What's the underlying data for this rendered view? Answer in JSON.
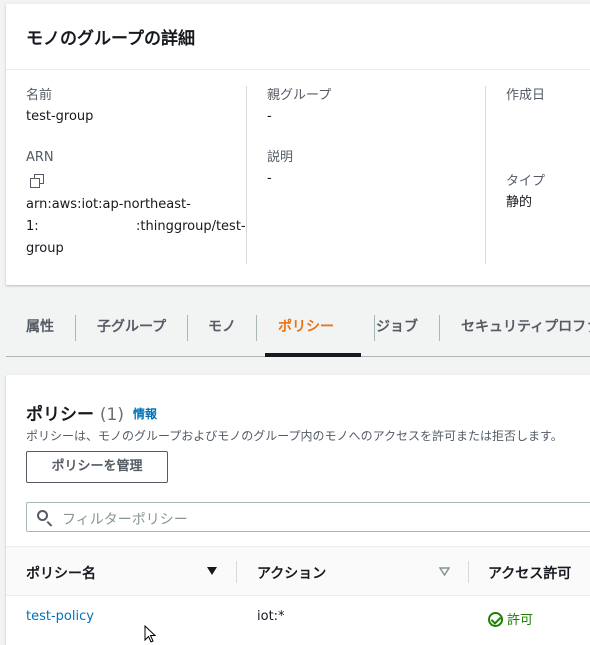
{
  "details": {
    "title": "モノのグループの詳細",
    "name_label": "名前",
    "name_value": "test-group",
    "arn_label": "ARN",
    "arn_line1": "arn:aws:iot:ap-northeast-",
    "arn_line2_start": "1:",
    "arn_line2_end": ":thinggroup/test-",
    "arn_line3": "group",
    "parent_label": "親グループ",
    "parent_value": "-",
    "desc_label": "説明",
    "desc_value": "-",
    "created_label": "作成日",
    "type_label": "タイプ",
    "type_value": "静的"
  },
  "tabs": [
    "属性",
    "子グループ",
    "モノ",
    "ポリシー",
    "ジョブ",
    "セキュリティプロファ"
  ],
  "active_tab": "ポリシー",
  "policies": {
    "title": "ポリシー",
    "count": "(1)",
    "info": "情報",
    "description": "ポリシーは、モノのグループおよびモノのグループ内のモノへのアクセスを許可または拒否します。",
    "manage_button": "ポリシーを管理",
    "filter_placeholder": "フィルターポリシー",
    "columns": [
      "ポリシー名",
      "アクション",
      "アクセス許可"
    ],
    "rows": [
      {
        "name": "test-policy",
        "action": "iot:*",
        "permission": "許可"
      }
    ]
  },
  "colors": {
    "accent": "#ec7211",
    "link": "#0073bb",
    "success": "#1d8102"
  }
}
